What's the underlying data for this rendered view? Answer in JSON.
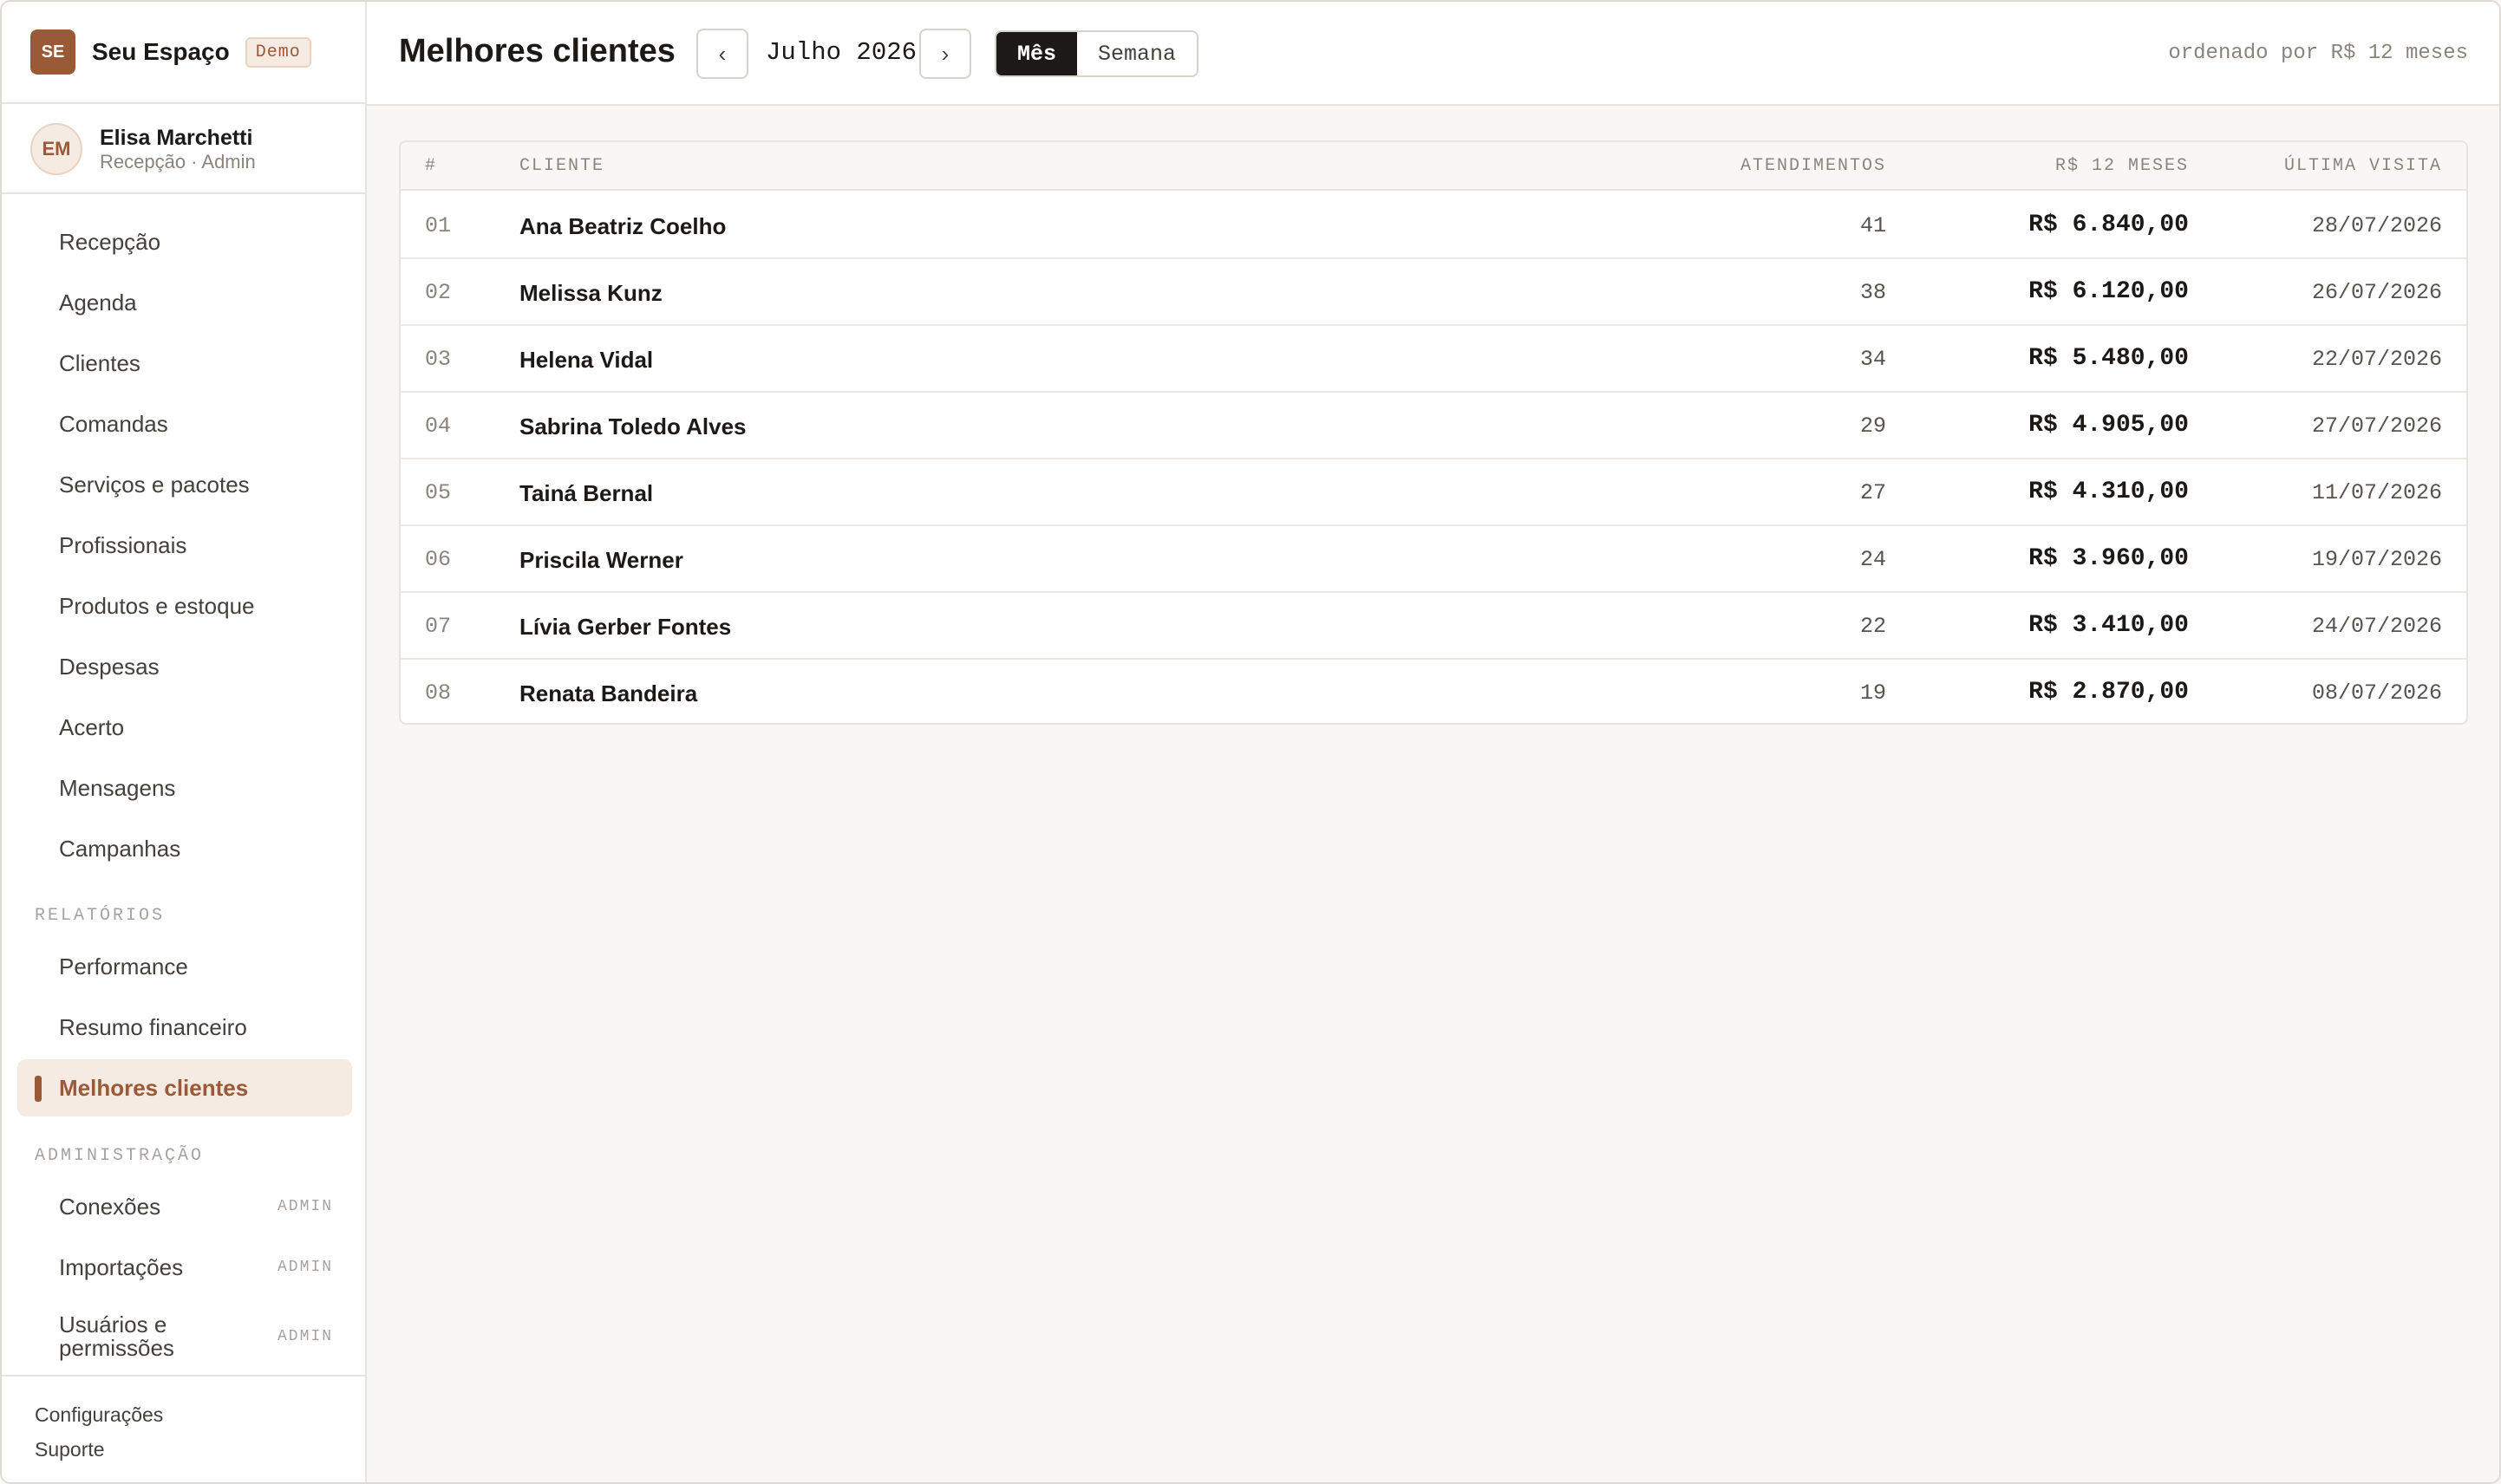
{
  "brand": {
    "initials": "SE",
    "name": "Seu Espaço",
    "badge": "Demo"
  },
  "user": {
    "initials": "EM",
    "name": "Elisa Marchetti",
    "role": "Recepção · Admin"
  },
  "sidebar": {
    "main_items": [
      "Recepção",
      "Agenda",
      "Clientes",
      "Comandas",
      "Serviços e pacotes",
      "Profissionais",
      "Produtos e estoque",
      "Despesas",
      "Acerto",
      "Mensagens",
      "Campanhas"
    ],
    "reports_label": "RELATÓRIOS",
    "report_items": [
      "Performance",
      "Resumo financeiro",
      "Melhores clientes"
    ],
    "active_item": "Melhores clientes",
    "admin_label": "ADMINISTRAÇÃO",
    "admin_items": [
      {
        "label": "Conexões",
        "badge": "ADMIN"
      },
      {
        "label": "Importações",
        "badge": "ADMIN"
      },
      {
        "label": "Usuários e permissões",
        "badge": "ADMIN"
      }
    ],
    "footer": [
      "Configurações",
      "Suporte"
    ]
  },
  "header": {
    "title": "Melhores clientes",
    "prev": "‹",
    "next": "›",
    "period": "Julho 2026",
    "views": [
      "Mês",
      "Semana"
    ],
    "active_view": "Mês",
    "sort_note": "ordenado por R$ 12 meses"
  },
  "table": {
    "columns": [
      "#",
      "CLIENTE",
      "ATENDIMENTOS",
      "R$ 12 MESES",
      "ÚLTIMA VISITA"
    ],
    "rows": [
      {
        "rank": "01",
        "name": "Ana Beatriz Coelho",
        "visits": "41",
        "amount": "R$ 6.840,00",
        "last": "28/07/2026"
      },
      {
        "rank": "02",
        "name": "Melissa Kunz",
        "visits": "38",
        "amount": "R$ 6.120,00",
        "last": "26/07/2026"
      },
      {
        "rank": "03",
        "name": "Helena Vidal",
        "visits": "34",
        "amount": "R$ 5.480,00",
        "last": "22/07/2026"
      },
      {
        "rank": "04",
        "name": "Sabrina Toledo Alves",
        "visits": "29",
        "amount": "R$ 4.905,00",
        "last": "27/07/2026"
      },
      {
        "rank": "05",
        "name": "Tainá Bernal",
        "visits": "27",
        "amount": "R$ 4.310,00",
        "last": "11/07/2026"
      },
      {
        "rank": "06",
        "name": "Priscila Werner",
        "visits": "24",
        "amount": "R$ 3.960,00",
        "last": "19/07/2026"
      },
      {
        "rank": "07",
        "name": "Lívia Gerber Fontes",
        "visits": "22",
        "amount": "R$ 3.410,00",
        "last": "24/07/2026"
      },
      {
        "rank": "08",
        "name": "Renata Bandeira",
        "visits": "19",
        "amount": "R$ 2.870,00",
        "last": "08/07/2026"
      }
    ]
  }
}
